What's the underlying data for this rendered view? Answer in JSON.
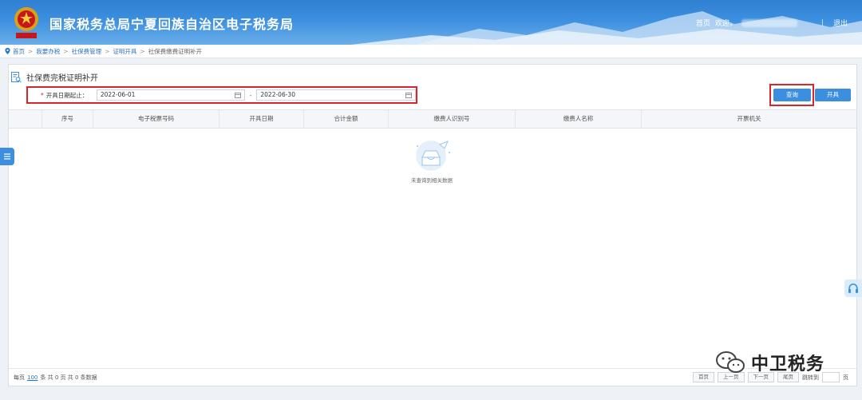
{
  "header": {
    "title": "国家税务总局宁夏回族自治区电子税务局",
    "nav": {
      "home": "首页",
      "welcome": "欢迎，",
      "logout": "退出"
    }
  },
  "breadcrumb": {
    "items": [
      "首页",
      "我要办税",
      "社保费管理",
      "证明开具",
      "社保费缴费证明补开"
    ]
  },
  "page": {
    "title": "社保费完税证明补开"
  },
  "filter": {
    "label": "开具日期起止：",
    "required_mark": "*",
    "start_date": "2022-06-01",
    "separator": "-",
    "end_date": "2022-06-30"
  },
  "buttons": {
    "query": "查询",
    "issue": "开具"
  },
  "table": {
    "columns": [
      "",
      "序号",
      "电子税票号码",
      "开具日期",
      "合计金额",
      "缴费人识别号",
      "缴费人名称",
      "开票机关"
    ],
    "empty_text": "未查询到相关数据"
  },
  "footer": {
    "prefix": "每页",
    "page_size": "100",
    "suffix": "条 共 0 页   共 0 条数据",
    "first": "首页",
    "prev": "上一页",
    "next": "下一页",
    "last": "尾页",
    "goto": "跳转到",
    "page_unit": "页"
  },
  "watermark": {
    "text": "中卫税务"
  },
  "colors": {
    "accent": "#3b8fde",
    "highlight": "#d8262f",
    "header": "#2f7fd1"
  }
}
